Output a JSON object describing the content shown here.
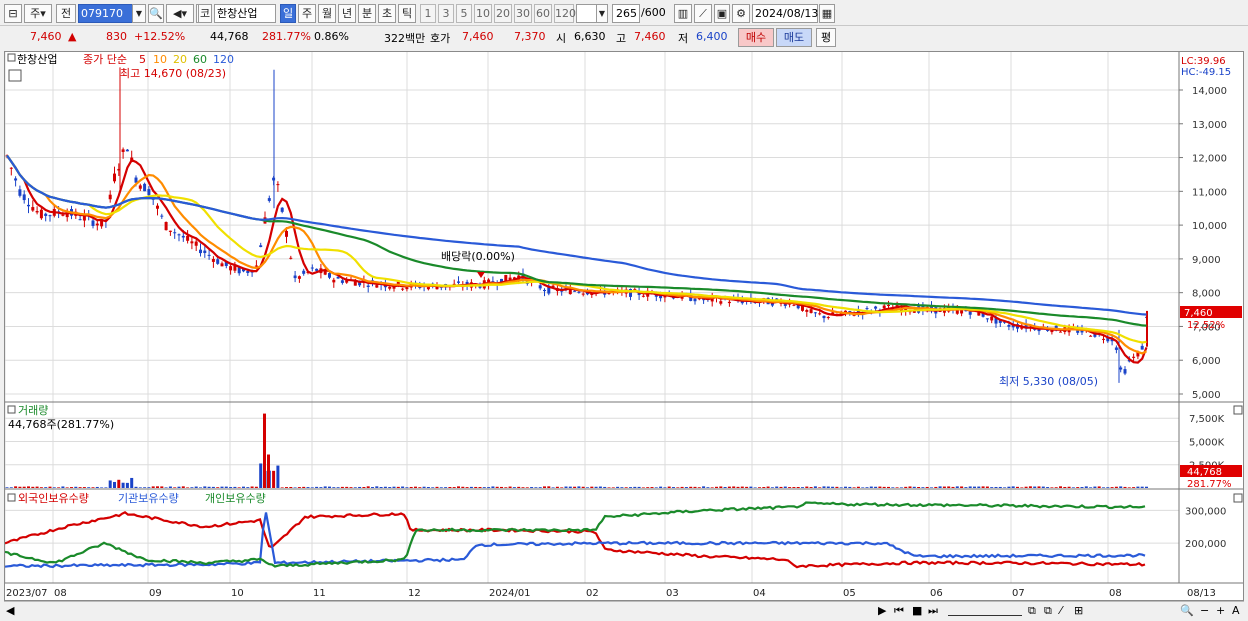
{
  "toolbar": {
    "day_tab": "주",
    "jeon_label": "전",
    "code_value": "079170",
    "code_label": "코",
    "stock_name": "한창산업",
    "periods": [
      "일",
      "주",
      "월",
      "년",
      "분",
      "초",
      "틱"
    ],
    "intervals": [
      "1",
      "3",
      "5",
      "10",
      "20",
      "30",
      "60",
      "120"
    ],
    "count_value": "265",
    "count_total": "/600",
    "date_value": "2024/08/13"
  },
  "quote": {
    "price": "7,460",
    "arrow": "▲",
    "change": "830",
    "change_pct": "+12.52%",
    "volume": "44,768",
    "volume_pct": "281.77%",
    "turnover_pct": "0.86%",
    "amount": "322백만",
    "ask_label": "호가",
    "ask": "7,460",
    "bid": "7,370",
    "open_label": "시",
    "open": "6,630",
    "high_label": "고",
    "high": "7,460",
    "low_label": "저",
    "low": "6,400",
    "buy_button": "매수",
    "sell_button": "매도",
    "eval_button": "평"
  },
  "price_pane": {
    "stock_label": "한창산업",
    "ma_label": "종가 단순",
    "ma_periods": [
      "5",
      "10",
      "20",
      "60",
      "120"
    ],
    "ma_colors": [
      "#d40000",
      "#ff8c00",
      "#f0e000",
      "#1a8a2a",
      "#2a5ad8"
    ],
    "high_annot": "최고 14,670 (08/23)",
    "low_annot": "최저 5,330 (08/05)",
    "dividend_annot": "배당락(0.00%)",
    "lc": "LC:39.96",
    "hc": "HC:-49.15",
    "y_ticks": [
      "14,000",
      "13,000",
      "12,000",
      "11,000",
      "10,000",
      "9,000",
      "8,000",
      "7,000",
      "6,000",
      "5,000"
    ],
    "last_price_tag": "7,460",
    "last_pct_tag": "12.52%"
  },
  "volume_pane": {
    "title": "거래량",
    "value": "44,768주(281.77%)",
    "y_ticks": [
      "7,500K",
      "5,000K",
      "2,500K"
    ],
    "last_tag": "44,768",
    "last_pct": "281.77%"
  },
  "holdings_pane": {
    "series": [
      {
        "name": "외국인보유수량",
        "color": "#d40000"
      },
      {
        "name": "기관보유수량",
        "color": "#2a5ad8"
      },
      {
        "name": "개인보유수량",
        "color": "#1a8a2a"
      }
    ],
    "y_ticks": [
      "300,000",
      "200,000"
    ]
  },
  "x_axis": {
    "labels": [
      "2023/07",
      "08",
      "09",
      "10",
      "11",
      "12",
      "2024/01",
      "02",
      "03",
      "04",
      "05",
      "06",
      "07",
      "08"
    ],
    "end_label": "08/13"
  }
}
